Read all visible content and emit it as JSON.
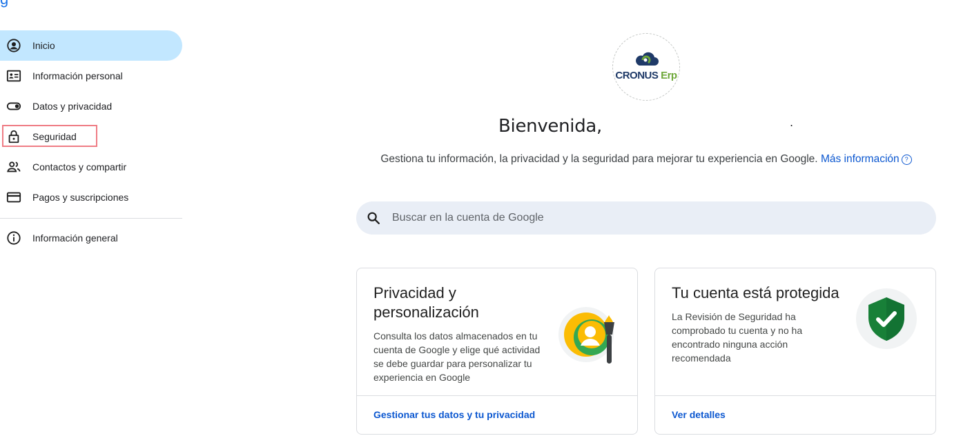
{
  "header": {
    "partial_text": "g"
  },
  "sidebar": {
    "items": [
      {
        "label": "Inicio",
        "icon": "account-circle-icon"
      },
      {
        "label": "Información personal",
        "icon": "id-card-icon"
      },
      {
        "label": "Datos y privacidad",
        "icon": "toggle-icon"
      },
      {
        "label": "Seguridad",
        "icon": "lock-icon"
      },
      {
        "label": "Contactos y compartir",
        "icon": "people-icon"
      },
      {
        "label": "Pagos y suscripciones",
        "icon": "credit-card-icon"
      }
    ],
    "footer_items": [
      {
        "label": "Información general",
        "icon": "info-icon"
      }
    ]
  },
  "main": {
    "avatar": {
      "logo_text_1": "CRONUS",
      "logo_text_2": "Erp"
    },
    "welcome": "Bienvenida,",
    "subtitle": {
      "text": "Gestiona tu información, la privacidad y la seguridad para mejorar tu experiencia en Google.",
      "link": "Más información",
      "help_glyph": "?"
    },
    "search": {
      "placeholder": "Buscar en la cuenta de Google"
    },
    "cards": [
      {
        "title": "Privacidad y personalización",
        "description": "Consulta los datos almacenados en tu cuenta de Google y elige qué actividad se debe guardar para personalizar tu experiencia en Google",
        "link": "Gestionar tus datos y tu privacidad"
      },
      {
        "title": "Tu cuenta está protegida",
        "description": "La Revisión de Seguridad ha comprobado tu cuenta y no ha encontrado ninguna acción recomendada",
        "link": "Ver detalles"
      }
    ]
  },
  "colors": {
    "active_nav_bg": "#c2e7ff",
    "link": "#0b57d0",
    "search_bg": "#e9eef6",
    "highlight_border": "#ef7c84",
    "shield_green": "#188038"
  }
}
